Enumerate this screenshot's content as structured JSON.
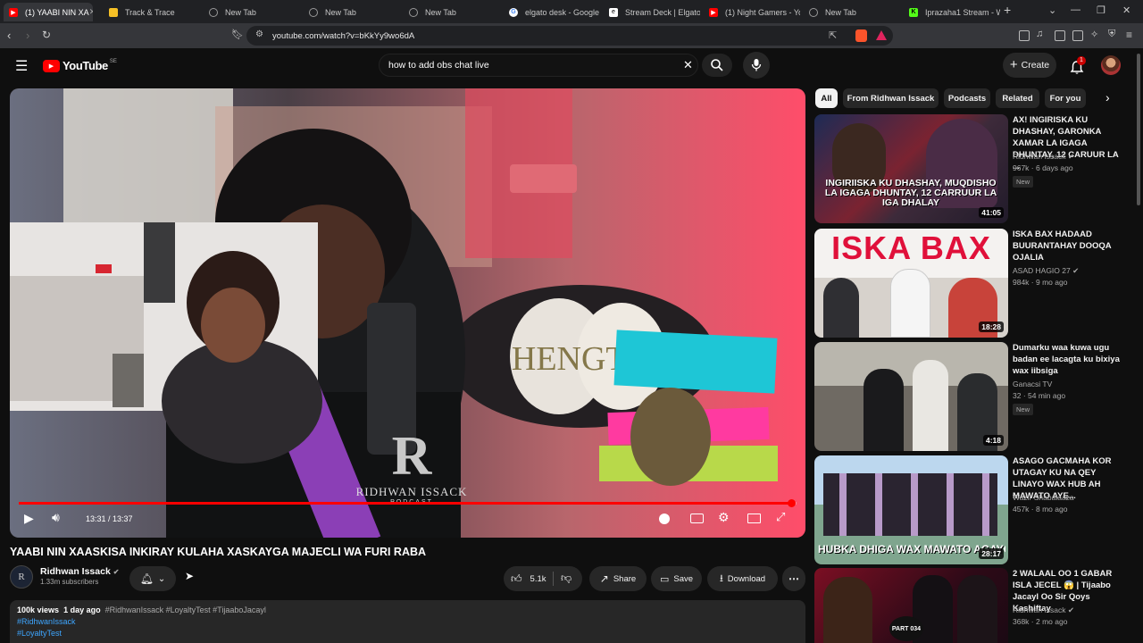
{
  "browser": {
    "tabs": [
      {
        "label": "(1) YAABI NIN XA",
        "icon": "youtube-icon",
        "color": "#ff0000"
      },
      {
        "label": "Track & Trace",
        "icon": "square-icon",
        "color": "#f6c026"
      },
      {
        "label": "New Tab",
        "icon": "globe-icon",
        "color": "#888888"
      },
      {
        "label": "New Tab",
        "icon": "globe-icon",
        "color": "#888888"
      },
      {
        "label": "New Tab",
        "icon": "globe-icon",
        "color": "#888888"
      },
      {
        "label": "elgato desk - Google",
        "icon": "google-icon",
        "color": "#ffffff"
      },
      {
        "label": "Stream Deck | Elgato",
        "icon": "elgato-icon",
        "color": "#ffffff"
      },
      {
        "label": "(1) Night Gamers - Yo",
        "icon": "youtube-icon",
        "color": "#ff0000"
      },
      {
        "label": "New Tab",
        "icon": "globe-icon",
        "color": "#888888"
      },
      {
        "label": "Iprazaha1 Stream - W",
        "icon": "kick-icon",
        "color": "#53fc18"
      }
    ],
    "url": "youtube.com/watch?v=bKkYy9wo6dA"
  },
  "youtube": {
    "logo_text": "YouTube",
    "region": "SE",
    "search_value": "how to add obs chat live",
    "create_label": "Create",
    "notif_count": "1"
  },
  "player": {
    "time": "13:31 / 13:37",
    "progress": 0.993,
    "logo_letters": "R",
    "logo_name": "RIDHWAN ISSACK",
    "logo_sub": "PODCAST"
  },
  "video": {
    "title": "YAABI NIN XAASKISA INKIRAY KULAHA XASKAYGA MAJECLI WA FURI RABA",
    "channel": "Ridhwan Issack",
    "subscribers": "1.33m subscribers",
    "likes": "5.1k",
    "share_label": "Share",
    "save_label": "Save",
    "download_label": "Download",
    "views": "100k views",
    "age": "1 day ago",
    "tags": "#RidhwanIssack #LoyaltyTest #TijaaboJacayl",
    "tag_line_1": "#RidhwanIssack",
    "tag_line_2": "#LoyaltyTest"
  },
  "chips": [
    "All",
    "From Ridhwan Issack",
    "Podcasts",
    "Related",
    "For you"
  ],
  "sidebar": [
    {
      "title": "AX! INGIRISKA KU DHASHAY, GARONKA XAMAR LA IGAGA DHUNTAY, 12 CARUUR LA ...",
      "channel": "Ridhwan Issack",
      "meta": "967k · 6 days ago",
      "badge": "New",
      "duration": "41:05",
      "thumb_text": "INGIRIISKA KU DHASHAY, MUQDISHO LA IGAGA DHUNTAY, 12 CARRUUR LA IGA DHALAY"
    },
    {
      "title": "ISKA BAX HADAAD BUURANTAHAY DOOQA OJALIA",
      "channel": "ASAD HAGIO 27",
      "meta": "984k · 9 mo ago",
      "badge": "",
      "duration": "18:28",
      "thumb_text": "ISKA BAX"
    },
    {
      "title": "Dumarku waa kuwa ugu badan ee lacagta ku bixiya wax iibsiga",
      "channel": "Ganacsi TV",
      "meta": "32 · 54 min ago",
      "badge": "New",
      "duration": "4:18",
      "thumb_text": ""
    },
    {
      "title": "ASAGO GACMAHA KOR UTAGAY KU NA QEY LINAYO WAX HUB AH MAWATO AYE...",
      "channel": "Wazir Shabalaaza",
      "meta": "457k · 8 mo ago",
      "badge": "",
      "duration": "28:17",
      "thumb_text": "HUBKA DHIGA WAX MAWATO AGAYO"
    },
    {
      "title": "2 WALAAL OO 1 GABAR ISLA JECEL 😱 | Tijaabo Jacayl Oo Sir Qoys Kashiftay",
      "channel": "Ridhwan Issack",
      "meta": "368k · 2 mo ago",
      "badge": "",
      "duration": "",
      "thumb_text": "PART 034"
    }
  ],
  "colors": {
    "accent": "#ff0000",
    "link": "#3ea6ff",
    "bg": "#0f0f0f"
  }
}
